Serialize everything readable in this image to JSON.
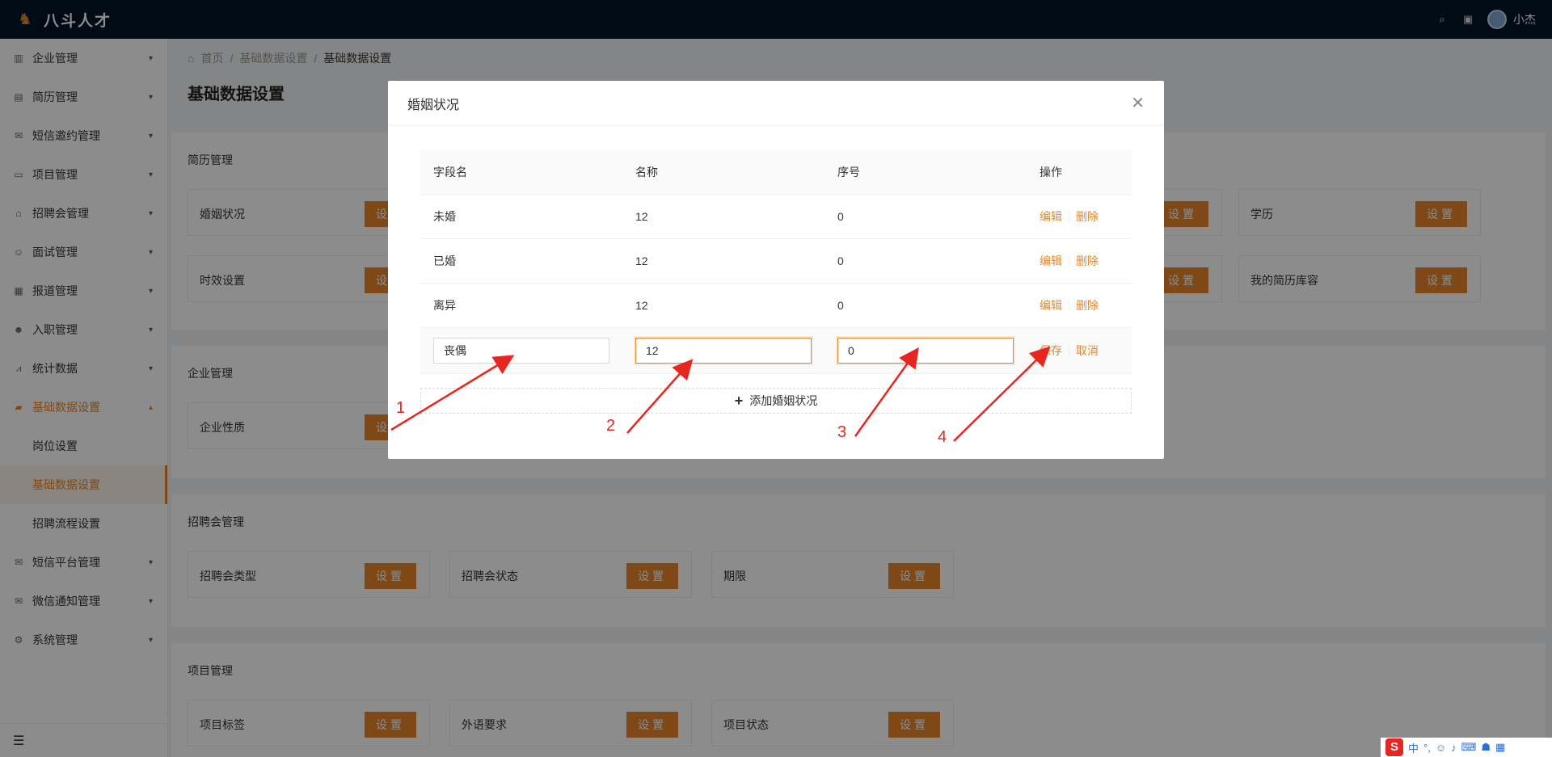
{
  "header": {
    "brand": "八斗人才",
    "user": "小杰"
  },
  "sidebar": {
    "items": [
      {
        "label": "企业管理",
        "icon": "building-icon"
      },
      {
        "label": "简历管理",
        "icon": "document-icon"
      },
      {
        "label": "短信邀约管理",
        "icon": "mail-icon"
      },
      {
        "label": "项目管理",
        "icon": "briefcase-icon"
      },
      {
        "label": "招聘会管理",
        "icon": "fair-icon"
      },
      {
        "label": "面试管理",
        "icon": "interview-icon"
      },
      {
        "label": "报道管理",
        "icon": "report-icon"
      },
      {
        "label": "入职管理",
        "icon": "user-icon"
      },
      {
        "label": "统计数据",
        "icon": "chart-icon"
      },
      {
        "label": "基础数据设置",
        "icon": "folder-icon"
      }
    ],
    "submenu": [
      "岗位设置",
      "基础数据设置",
      "招聘流程设置"
    ],
    "items_after": [
      {
        "label": "短信平台管理",
        "icon": "mail-icon"
      },
      {
        "label": "微信通知管理",
        "icon": "wechat-icon"
      },
      {
        "label": "系统管理",
        "icon": "gear-icon"
      }
    ]
  },
  "breadcrumb": [
    "首页",
    "基础数据设置",
    "基础数据设置"
  ],
  "page_title": "基础数据设置",
  "set_label": "设置",
  "sections": {
    "resume": {
      "title": "简历管理",
      "cards": [
        "婚姻状况",
        "时效设置",
        "学历",
        "我的简历库容"
      ]
    },
    "company": {
      "title": "企业管理",
      "cards": [
        "企业性质"
      ]
    },
    "fair": {
      "title": "招聘会管理",
      "cards": [
        "招聘会类型",
        "招聘会状态",
        "期限"
      ]
    },
    "project": {
      "title": "项目管理",
      "cards": [
        "项目标签",
        "外语要求",
        "项目状态"
      ]
    }
  },
  "modal": {
    "title": "婚姻状况",
    "columns": [
      "字段名",
      "名称",
      "序号",
      "操作"
    ],
    "rows": [
      {
        "field": "未婚",
        "name": "12",
        "order": "0"
      },
      {
        "field": "已婚",
        "name": "12",
        "order": "0"
      },
      {
        "field": "离异",
        "name": "12",
        "order": "0"
      }
    ],
    "edit_label": "编辑",
    "delete_label": "删除",
    "editing_row": {
      "field": "丧偶",
      "name": "12",
      "order": "0"
    },
    "save_label": "保存",
    "cancel_label": "取消",
    "add_label": "添加婚姻状况"
  },
  "annotations": [
    "1",
    "2",
    "3",
    "4"
  ],
  "ime": {
    "lang": "中",
    "punct": "°,"
  },
  "colors": {
    "accent": "#e5862a",
    "header_bg": "#001529",
    "annotation": "#e8261f"
  }
}
